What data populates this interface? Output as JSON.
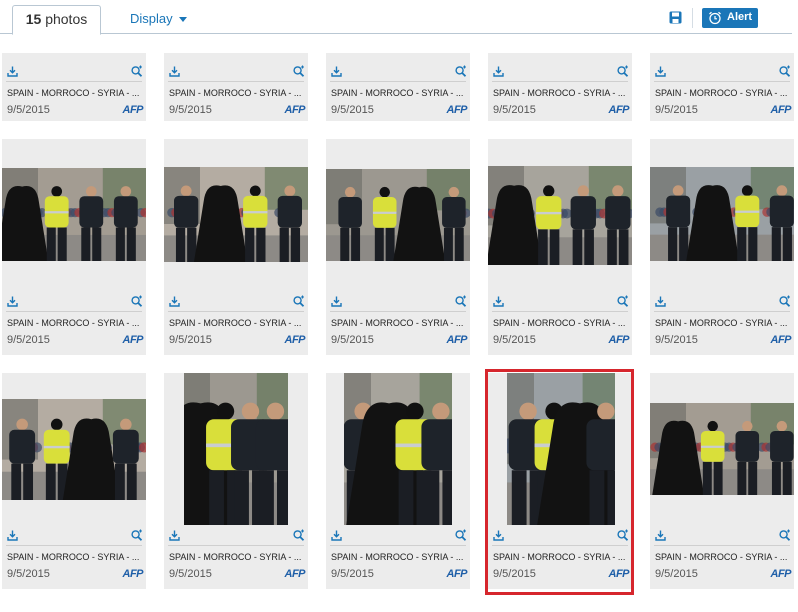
{
  "toolbar": {
    "count_number": "15",
    "count_label": "photos",
    "display_label": "Display",
    "alert_label": "Alert"
  },
  "card_defaults": {
    "caption": "SPAIN - MORROCO - SYRIA - ...",
    "date": "9/5/2015",
    "credit": "AFP"
  },
  "rows": [
    {
      "cards": [
        {
          "caption": "SPAIN - MORROCO - SYRIA - ...",
          "date": "9/5/2015",
          "credit": "AFP"
        },
        {
          "caption": "SPAIN - MORROCO - SYRIA - ...",
          "date": "9/5/2015",
          "credit": "AFP"
        },
        {
          "caption": "SPAIN - MORROCO - SYRIA - ...",
          "date": "9/5/2015",
          "credit": "AFP"
        },
        {
          "caption": "SPAIN - MORROCO - SYRIA - ...",
          "date": "9/5/2015",
          "credit": "AFP"
        },
        {
          "caption": "SPAIN - MORROCO - SYRIA - ...",
          "date": "9/5/2015",
          "credit": "AFP"
        }
      ]
    },
    {
      "cards": [
        {
          "caption": "SPAIN - MORROCO - SYRIA - ...",
          "date": "9/5/2015",
          "credit": "AFP"
        },
        {
          "caption": "SPAIN - MORROCO - SYRIA - ...",
          "date": "9/5/2015",
          "credit": "AFP"
        },
        {
          "caption": "SPAIN - MORROCO - SYRIA - ...",
          "date": "9/5/2015",
          "credit": "AFP"
        },
        {
          "caption": "SPAIN - MORROCO - SYRIA - ...",
          "date": "9/5/2015",
          "credit": "AFP"
        },
        {
          "caption": "SPAIN - MORROCO - SYRIA - ...",
          "date": "9/5/2015",
          "credit": "AFP"
        }
      ]
    },
    {
      "cards": [
        {
          "caption": "SPAIN - MORROCO - SYRIA - ...",
          "date": "9/5/2015",
          "credit": "AFP"
        },
        {
          "caption": "SPAIN - MORROCO - SYRIA - ...",
          "date": "9/5/2015",
          "credit": "AFP"
        },
        {
          "caption": "SPAIN - MORROCO - SYRIA - ...",
          "date": "9/5/2015",
          "credit": "AFP"
        },
        {
          "caption": "SPAIN - MORROCO - SYRIA - ...",
          "date": "9/5/2015",
          "credit": "AFP"
        },
        {
          "caption": "SPAIN - MORROCO - SYRIA - ...",
          "date": "9/5/2015",
          "credit": "AFP"
        }
      ]
    }
  ],
  "icons": {
    "save": "floppy-disk-icon",
    "alert": "alarm-clock-icon",
    "download": "download-icon",
    "zoom": "zoom-in-icon",
    "display_caret": "caret-down-icon"
  },
  "colors": {
    "accent": "#1a76b8",
    "credit_logo": "#1f5fa8",
    "selection": "#d6262d",
    "card_bg": "#ececec"
  },
  "selected_card": "row 3, card 4"
}
